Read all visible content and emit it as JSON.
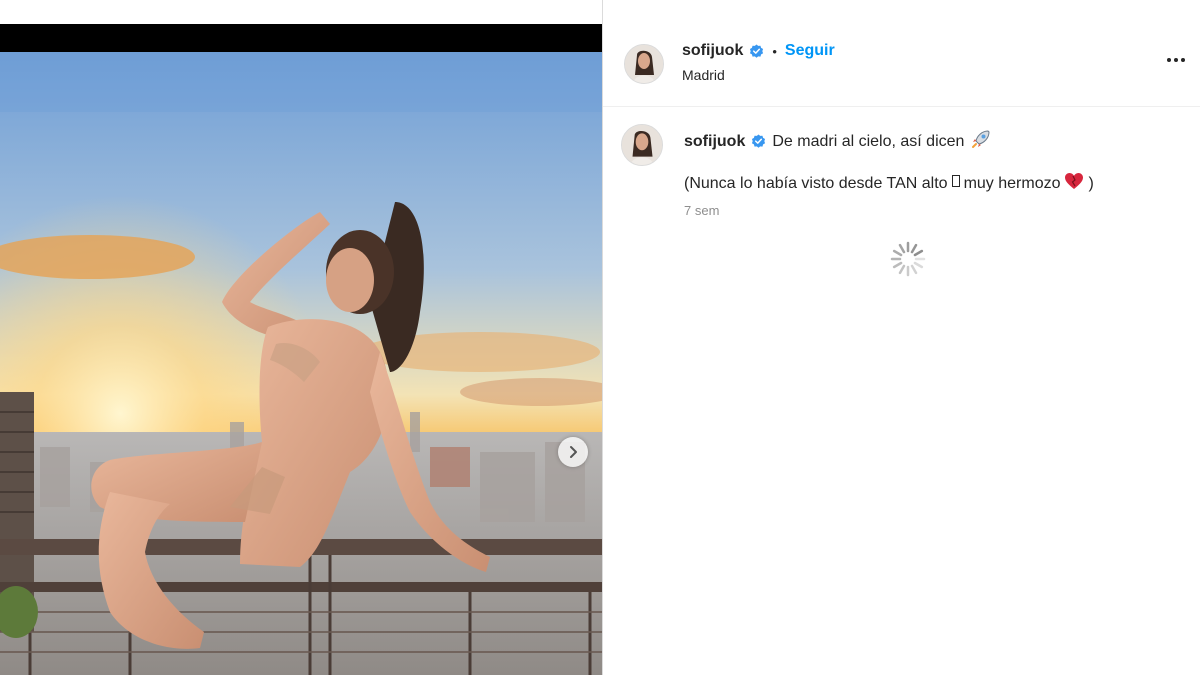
{
  "post": {
    "username": "sofijuok",
    "follow_label": "Seguir",
    "separator": "•",
    "location": "Madrid",
    "caption_line1": "De madri al cielo, así dicen",
    "caption_line2_part1": "(Nunca lo había visto desde TAN alto",
    "caption_line2_part2": "muy hermozo",
    "caption_line2_end": ")",
    "time_ago": "7 sem"
  },
  "icons": {
    "verified": "verified-badge-icon",
    "rocket": "rocket-emoji",
    "heart": "red-heart-emoji",
    "placeholder": "missing-glyph-box",
    "next": "chevron-right-icon",
    "more": "more-options-icon",
    "loading": "loading-spinner-icon"
  },
  "colors": {
    "link_blue": "#0095f6",
    "verified_blue": "#3897f0",
    "text": "#262626",
    "muted": "#8e8e8e"
  }
}
